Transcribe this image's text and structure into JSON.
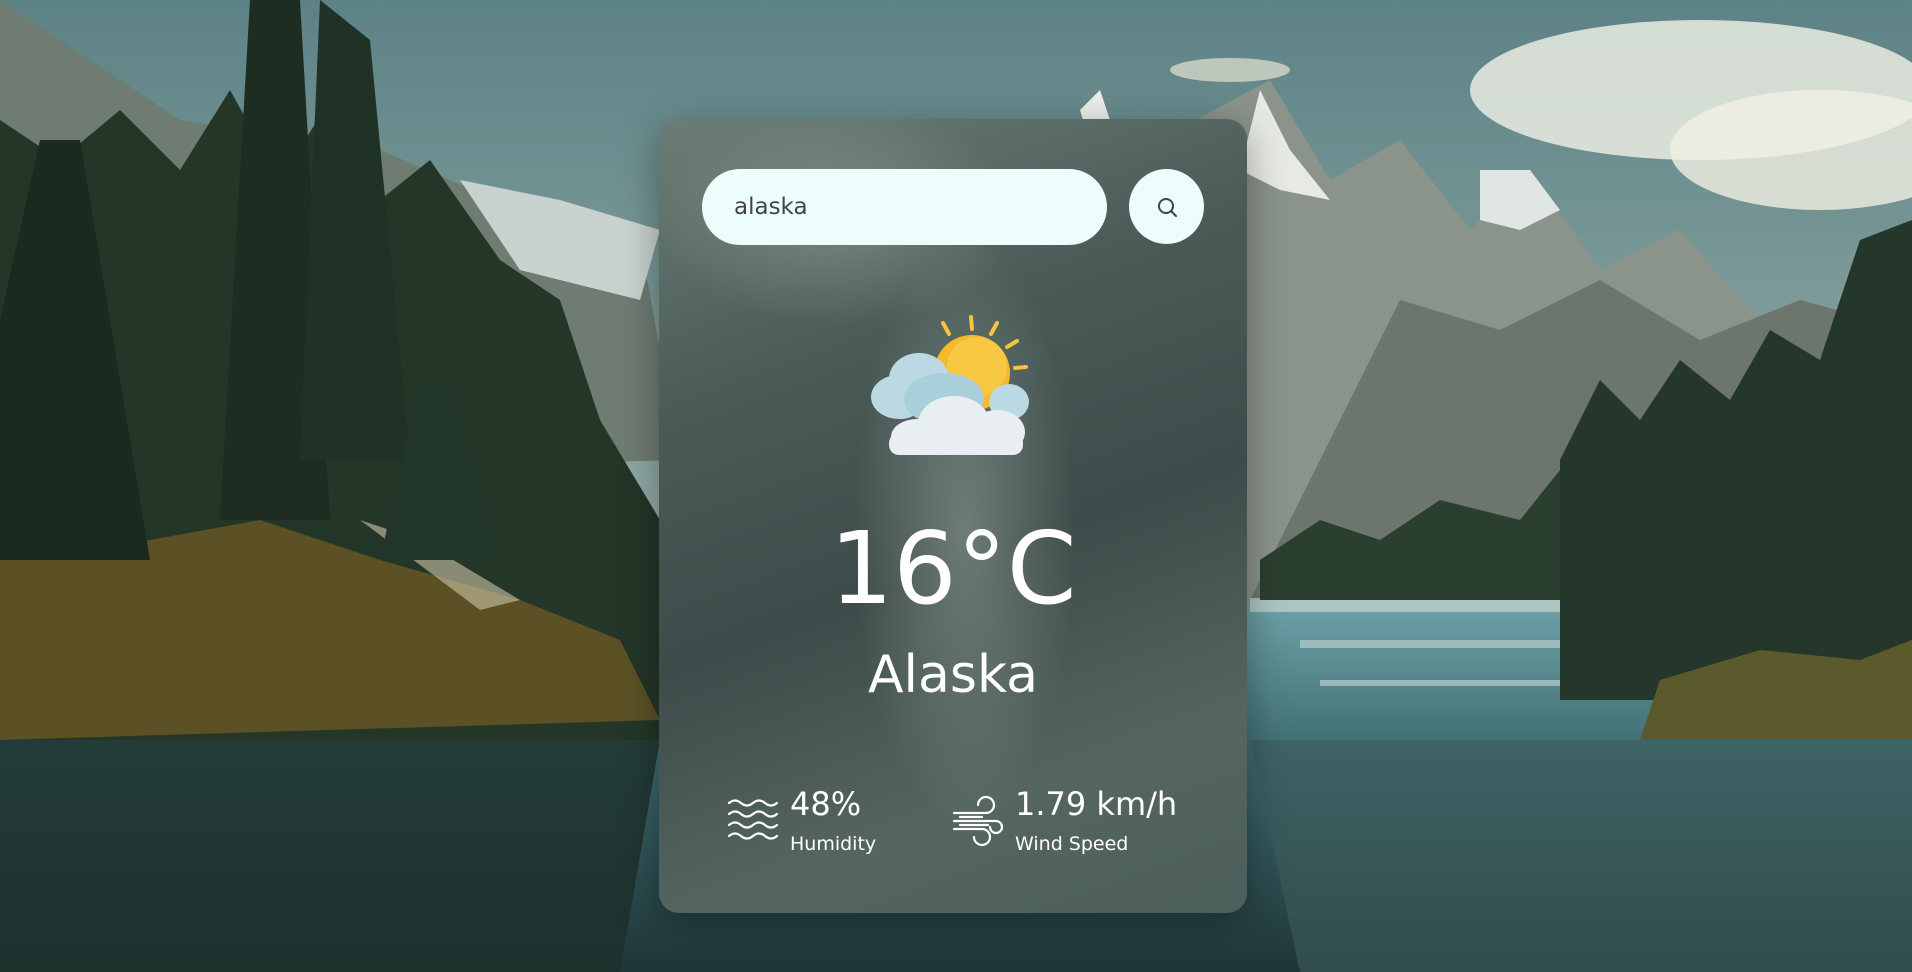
{
  "search": {
    "value": "alaska",
    "icon": "search-icon"
  },
  "weather": {
    "icon": "partly-cloudy-sun-icon",
    "temperature": "16°C",
    "city": "Alaska"
  },
  "details": {
    "humidity": {
      "value": "48%",
      "label": "Humidity",
      "icon": "humidity-waves-icon"
    },
    "wind": {
      "value": "1.79 km/h",
      "label": "Wind Speed",
      "icon": "wind-icon"
    }
  },
  "colors": {
    "input_background": "#ecfdfb",
    "text": "#ffffff",
    "sun": "#f6b92b",
    "cloud": "#cfe3ea"
  }
}
